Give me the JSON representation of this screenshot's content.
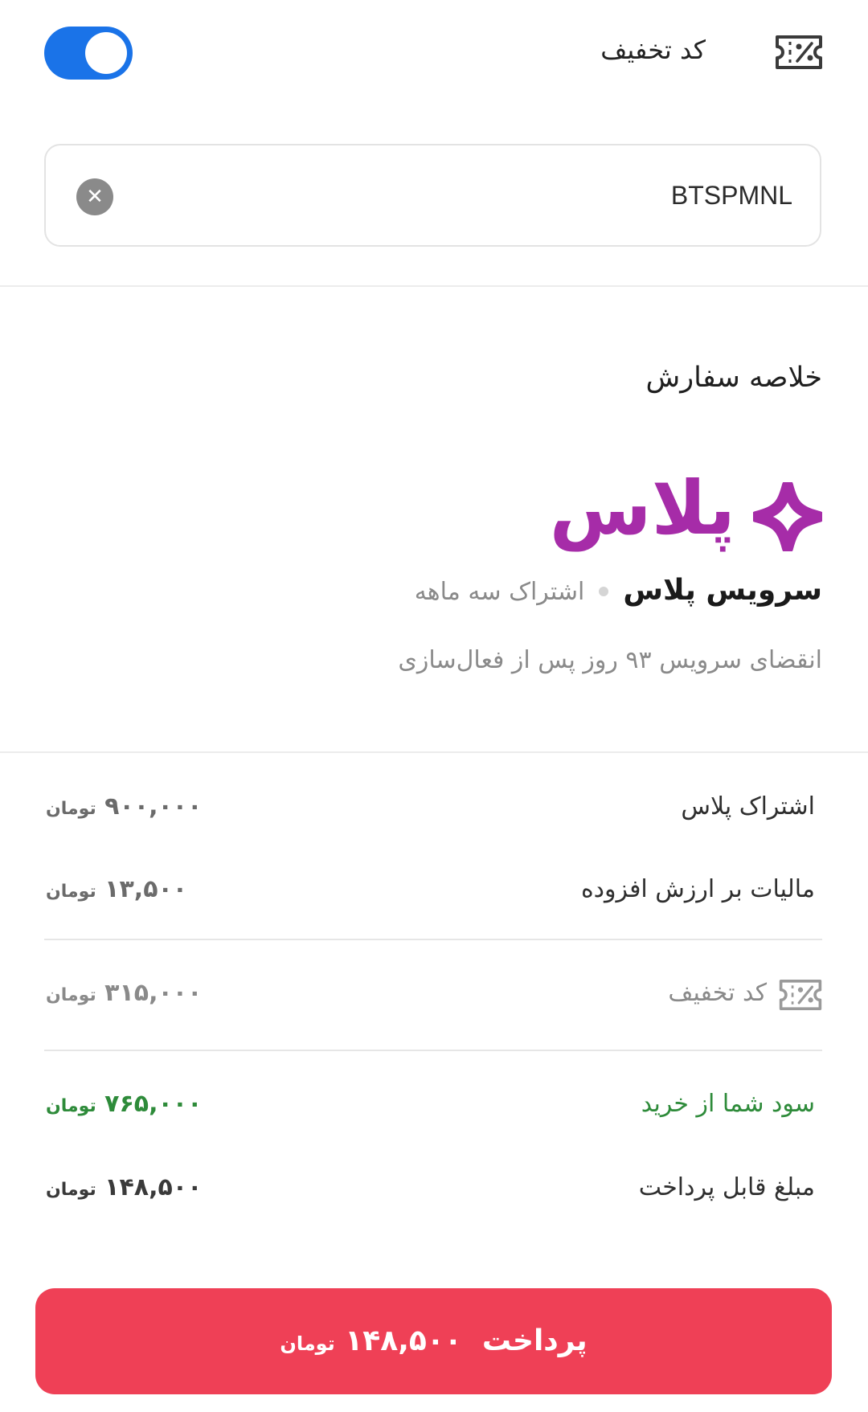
{
  "discount": {
    "label": "کد تخفیف",
    "enabled": true,
    "code": "BTSPMNL",
    "clear_glyph": "✕",
    "icon": "coupon-percent-icon"
  },
  "summary": {
    "title": "خلاصه سفارش",
    "brand": "پلاس",
    "brand_icon": "four-point-star-icon",
    "brand_color": "#a62ca8",
    "service_name": "سرویس پلاس",
    "service_sub": "اشتراک سه ماهه",
    "expiry": "انقضای سرویس ۹۳ روز پس از فعال‌سازی"
  },
  "rows": [
    {
      "label": "اشتراک پلاس",
      "amount": "۹۰۰,۰۰۰",
      "unit": "تومان",
      "color": "#6b6b6b"
    },
    {
      "label": "مالیات بر ارزش افزوده",
      "amount": "۱۳,۵۰۰",
      "unit": "تومان",
      "color": "#6b6b6b"
    },
    {
      "label": "کد تخفیف",
      "amount": "۳۱۵,۰۰۰",
      "unit": "تومان",
      "color": "#8a8a8a"
    },
    {
      "label": "سود شما از خرید",
      "amount": "۷۶۵,۰۰۰",
      "unit": "تومان",
      "color": "#2e8b3a"
    },
    {
      "label": "مبلغ قابل پرداخت",
      "amount": "۱۴۸,۵۰۰",
      "unit": "تومان",
      "color": "#3a3a3a"
    }
  ],
  "pay_button": {
    "label": "پرداخت",
    "amount": "۱۴۸,۵۰۰",
    "unit": "تومان",
    "color": "#ef4056"
  }
}
